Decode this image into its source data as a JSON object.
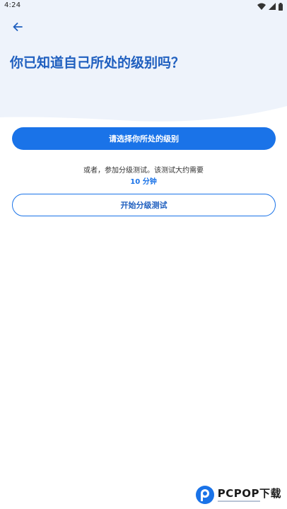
{
  "status_bar": {
    "time": "4:24",
    "icons": [
      "wifi-icon",
      "signal-icon",
      "battery-icon"
    ]
  },
  "header": {
    "back_icon": "arrow-left-icon",
    "title": "你已知道自己所处的级别吗？"
  },
  "actions": {
    "select_level_label": "请选择你所处的级别",
    "hint_text": "或者，参加分级测试。该测试大约需要",
    "hint_duration": "10 分钟",
    "start_test_label": "开始分级测试"
  },
  "watermark": {
    "logo_icon": "pcpop-logo-icon",
    "text": "PCPOP下载"
  },
  "colors": {
    "header_background": "#eef3fb",
    "primary": "#1a73e8",
    "title": "#1f5fbf",
    "text": "#333333",
    "background": "#ffffff"
  }
}
